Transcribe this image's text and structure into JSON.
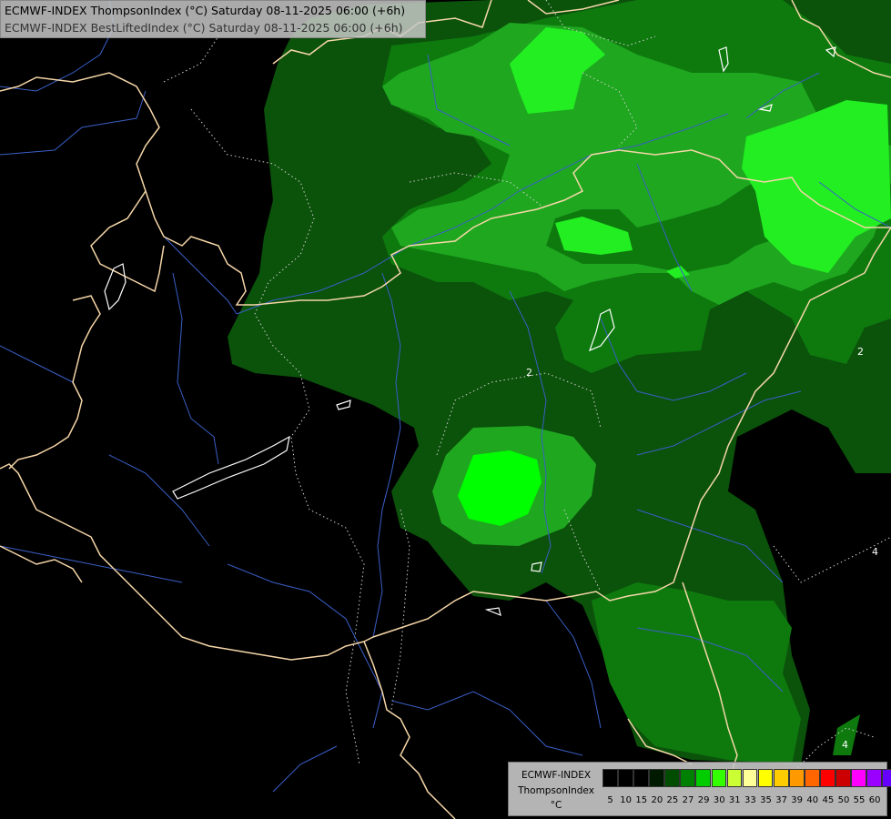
{
  "header": {
    "line1": "ECMWF-INDEX ThompsonIndex (°C) Saturday 08-11-2025 06:00 (+6h)",
    "line2": "ECMWF-INDEX BestLiftedIndex (°C) Saturday 08-11-2025 06:00 (+6h)"
  },
  "legend": {
    "title_line1": "ECMWF-INDEX",
    "title_line2": "ThompsonIndex",
    "title_line3": "°C",
    "ticks": [
      "5",
      "10",
      "15",
      "20",
      "25",
      "27",
      "29",
      "30",
      "31",
      "33",
      "35",
      "37",
      "39",
      "40",
      "45",
      "50",
      "55",
      "60"
    ],
    "colors": [
      "#000000",
      "#000000",
      "#000000",
      "#001a00",
      "#004d00",
      "#008000",
      "#00cc00",
      "#33ff00",
      "#ccff33",
      "#ffff99",
      "#ffff00",
      "#ffcc00",
      "#ff9900",
      "#ff6600",
      "#ff0000",
      "#cc0000",
      "#ff00ff",
      "#9900ff",
      "#6600ff",
      "#0000ff"
    ]
  },
  "map": {
    "contour_labels": [
      "2",
      "2",
      "4",
      "4"
    ],
    "colors": {
      "background": "#000000",
      "dark_green": "#0b520b",
      "mid_green": "#0e7a0e",
      "green": "#1fa81f",
      "bright_green": "#00ff00",
      "lime_green": "#22ee22",
      "border": "#f5d6a8",
      "river": "#3a5fc7",
      "lake": "#ffffff"
    }
  }
}
